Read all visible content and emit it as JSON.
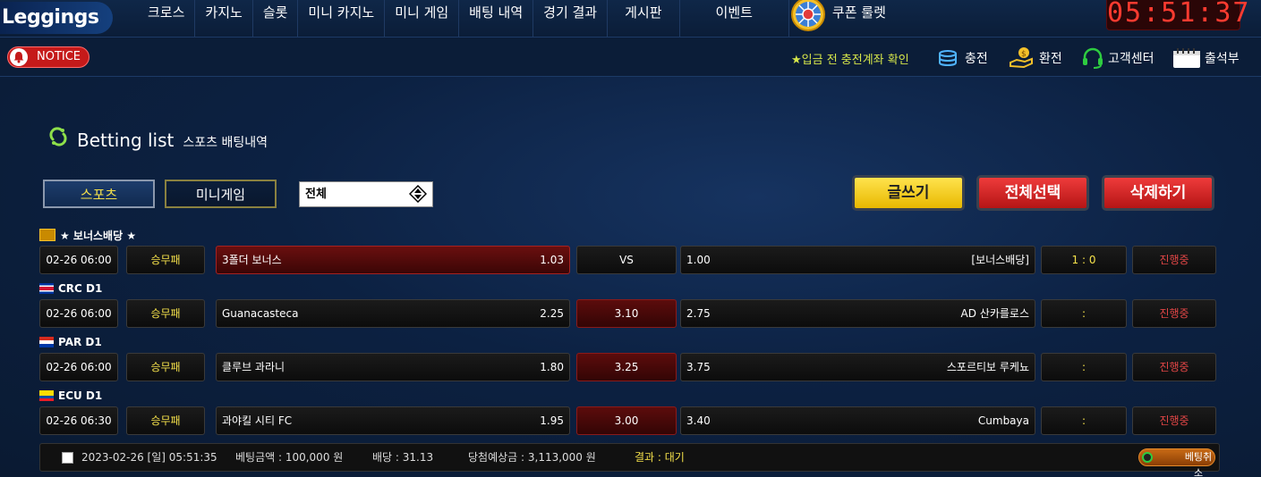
{
  "logo": "Leggings",
  "nav": {
    "items": [
      "크로스",
      "카지노",
      "슬롯",
      "미니 카지노",
      "미니 게임",
      "배팅 내역",
      "경기 결과",
      "게시판",
      "이벤트"
    ],
    "coupon": "쿠폰 룰렛"
  },
  "clock": "05:51:37",
  "subbar": {
    "notice": "NOTICE",
    "deposit_notice": "★입금 전 충전계좌 확인",
    "charge": "충전",
    "exchange": "환전",
    "support": "고객센터",
    "attendance": "출석부"
  },
  "page": {
    "title": "Betting list",
    "subtitle": "스포츠 배팅내역"
  },
  "tabs": {
    "sports": "스포츠",
    "minigame": "미니게임"
  },
  "filter": {
    "selected": "전체"
  },
  "buttons": {
    "write": "글쓰기",
    "select_all": "전체선택",
    "delete": "삭제하기"
  },
  "bets": [
    {
      "league": "★ 보너스배당 ★",
      "league_icon": "bonus-icon",
      "time": "02-26 06:00",
      "type": "승무패",
      "home": "3폴더 보너스",
      "home_odd": "1.03",
      "mid": "VS",
      "away_odd": "1.00",
      "away": "[보너스배당]",
      "score": "1 : 0",
      "status": "진행중",
      "selected": "home"
    },
    {
      "league": "CRC D1",
      "league_icon": "costa-rica-flag-icon",
      "time": "02-26 06:00",
      "type": "승무패",
      "home": "Guanacasteca",
      "home_odd": "2.25",
      "mid": "3.10",
      "away_odd": "2.75",
      "away": "AD 산카를로스",
      "score": ":",
      "status": "진행중",
      "selected": "draw"
    },
    {
      "league": "PAR D1",
      "league_icon": "paraguay-flag-icon",
      "time": "02-26 06:00",
      "type": "승무패",
      "home": "클루브 과라니",
      "home_odd": "1.80",
      "mid": "3.25",
      "away_odd": "3.75",
      "away": "스포르티보 루케뇨",
      "score": ":",
      "status": "진행중",
      "selected": "draw"
    },
    {
      "league": "ECU D1",
      "league_icon": "ecuador-flag-icon",
      "time": "02-26 06:30",
      "type": "승무패",
      "home": "과야킬 시티 FC",
      "home_odd": "1.95",
      "mid": "3.00",
      "away_odd": "3.40",
      "away": "Cumbaya",
      "score": ":",
      "status": "진행중",
      "selected": "draw"
    }
  ],
  "summary": {
    "datetime": "2023-02-26 [일] 05:51:35",
    "amount": "베팅금액 : 100,000 원",
    "odds": "배당 : 31.13",
    "expected": "당첨예상금 : 3,113,000 원",
    "result": "결과 : 대기",
    "cancel": "베팅취소"
  },
  "colors": {
    "accent_yellow": "#f5e14a",
    "status_red": "#e04545",
    "clock_red": "#ff3b30",
    "highlight_red": "#6a0f0f"
  }
}
